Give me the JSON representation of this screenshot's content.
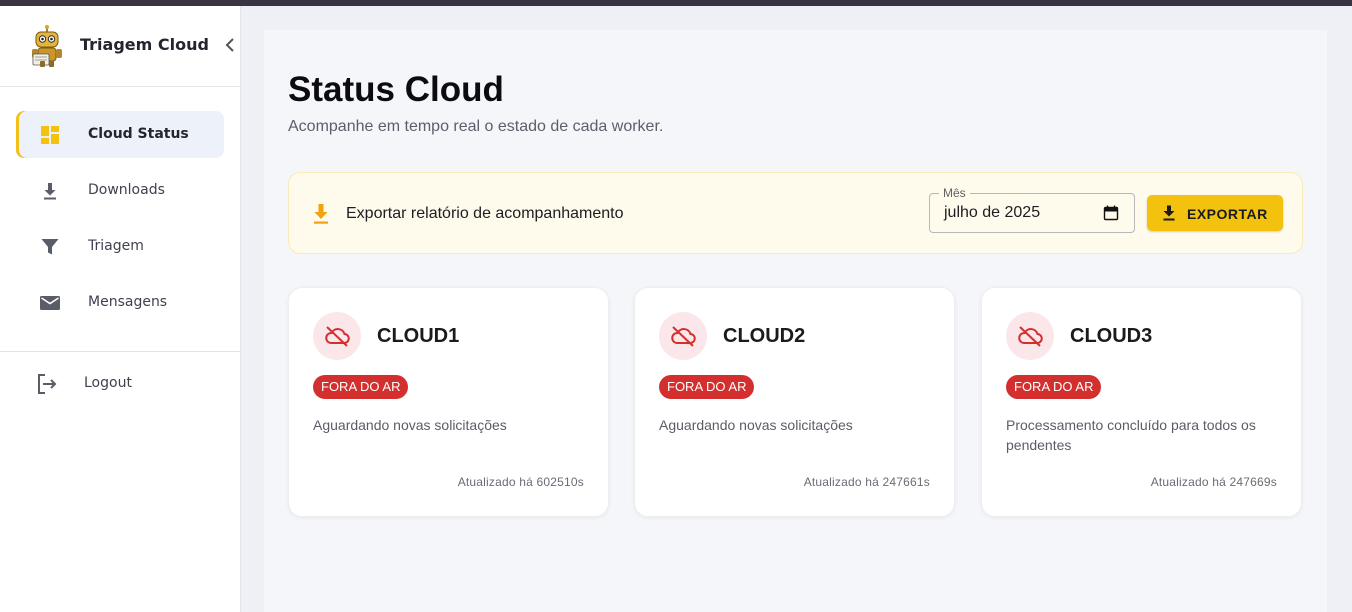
{
  "app": {
    "title": "Triagem Cloud"
  },
  "sidebar": {
    "items": [
      {
        "label": "Cloud Status",
        "icon": "dashboard-icon",
        "active": true
      },
      {
        "label": "Downloads",
        "icon": "download-icon"
      },
      {
        "label": "Triagem",
        "icon": "filter-icon"
      },
      {
        "label": "Mensagens",
        "icon": "mail-icon"
      }
    ],
    "logout_label": "Logout"
  },
  "page": {
    "title": "Status Cloud",
    "subtitle": "Acompanhe em tempo real o estado de cada worker."
  },
  "export": {
    "text": "Exportar relatório de acompanhamento",
    "month_label": "Mês",
    "month_value": "julho de 2025",
    "button_label": "EXPORTAR"
  },
  "clouds": [
    {
      "name": "CLOUD1",
      "status": "FORA DO AR",
      "message": "Aguardando novas solicitações",
      "updated": "Atualizado há 602510s"
    },
    {
      "name": "CLOUD2",
      "status": "FORA DO AR",
      "message": "Aguardando novas solicitações",
      "updated": "Atualizado há 247661s"
    },
    {
      "name": "CLOUD3",
      "status": "FORA DO AR",
      "message": "Processamento concluído para todos os pendentes",
      "updated": "Atualizado há 247669s"
    }
  ],
  "colors": {
    "accent": "#f2c20e",
    "offline_badge": "#d32f2f",
    "offline_icon_bg": "#fbe6ea",
    "offline_icon": "#d32f2f"
  }
}
